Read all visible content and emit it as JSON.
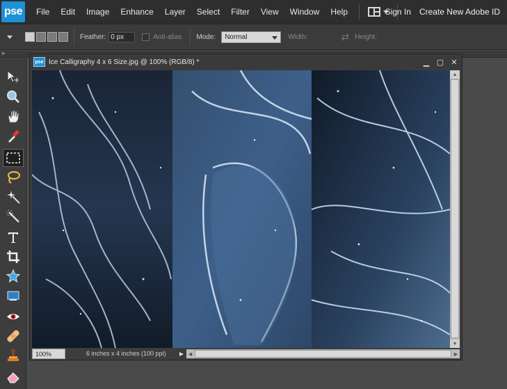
{
  "app": {
    "logo": "pse",
    "menu": [
      "File",
      "Edit",
      "Image",
      "Enhance",
      "Layer",
      "Select",
      "Filter",
      "View",
      "Window",
      "Help"
    ],
    "sign_in": "Sign In",
    "create_id": "Create New Adobe ID"
  },
  "options": {
    "feather_label": "Feather:",
    "feather_value": "0 px",
    "antialias_label": "Anti-alias",
    "mode_label": "Mode:",
    "mode_value": "Normal",
    "width_label": "Width:",
    "height_label": "Height:"
  },
  "tools": [
    {
      "name": "move-tool-icon"
    },
    {
      "name": "zoom-tool-icon"
    },
    {
      "name": "hand-tool-icon"
    },
    {
      "name": "eyedropper-tool-icon"
    },
    {
      "name": "rectangular-marquee-tool-icon",
      "active": true
    },
    {
      "name": "lasso-tool-icon"
    },
    {
      "name": "magic-wand-tool-icon"
    },
    {
      "name": "quick-selection-tool-icon"
    },
    {
      "name": "type-tool-icon"
    },
    {
      "name": "crop-tool-icon"
    },
    {
      "name": "cookie-cutter-tool-icon"
    },
    {
      "name": "straighten-tool-icon"
    },
    {
      "name": "red-eye-tool-icon"
    },
    {
      "name": "healing-brush-tool-icon"
    },
    {
      "name": "clone-stamp-tool-icon"
    },
    {
      "name": "eraser-tool-icon"
    }
  ],
  "document": {
    "icon_text": "pse",
    "title": "Ice Calligraphy 4 x 6 Size.jpg @ 100% (RGB/8) *",
    "zoom": "100%",
    "doc_size": "6 inches x 4 inches (100 ppi)"
  },
  "colors": {
    "accent": "#1e90d6",
    "panel_a": "#1b2738",
    "panel_b": "#3a5a82",
    "panel_c": "#1f3246"
  }
}
